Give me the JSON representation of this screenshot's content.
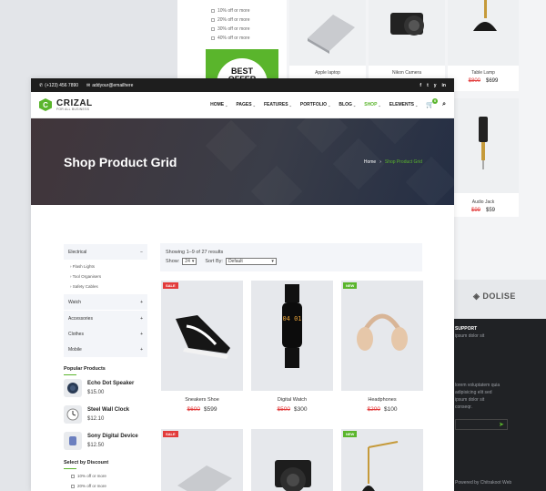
{
  "bg": {
    "discounts": [
      "10% off or more",
      "20% off or more",
      "30% off or more",
      "40% off or more"
    ],
    "offer_text": "BEST OFFER",
    "products": [
      {
        "name": "Apple laptop",
        "old": "",
        "price": ""
      },
      {
        "name": "Nikon Camera",
        "old": "",
        "price": ""
      },
      {
        "name": "Table Lamp",
        "old": "$800",
        "price": "$699"
      },
      {
        "name": "Audio Jack",
        "old": "$99",
        "price": "$59"
      }
    ],
    "footer": {
      "logo": "DOLISE",
      "support_title": "SUPPORT",
      "support_text": "ipsum dolor sit",
      "lines": [
        "lorem voluptatem quia",
        "adipisicing elit sed",
        "ipsum dolor sit",
        "conseqr."
      ],
      "copyright": "Powered by Chitrakoot Web"
    }
  },
  "topbar": {
    "phone": "(+123) 456 7890",
    "email": "addyour@emailhere",
    "social": [
      "f",
      "t",
      "y",
      "in"
    ]
  },
  "brand": {
    "name": "CRIZAL",
    "tagline": "FOR ALL BUSINESS"
  },
  "menu": [
    {
      "label": "HOME",
      "active": false
    },
    {
      "label": "PAGES",
      "active": false
    },
    {
      "label": "FEATURES",
      "active": false
    },
    {
      "label": "PORTFOLIO",
      "active": false
    },
    {
      "label": "BLOG",
      "active": false
    },
    {
      "label": "SHOP",
      "active": true
    },
    {
      "label": "ELEMENTS",
      "active": false
    }
  ],
  "cart_count": "0",
  "banner": {
    "title": "Shop Product Grid",
    "crumb_home": "Home",
    "crumb_current": "Shop Product Grid"
  },
  "sidebar": {
    "categories": [
      {
        "label": "Electrical",
        "sign": "−"
      },
      {
        "label": "Watch",
        "sign": "+"
      },
      {
        "label": "Accessories",
        "sign": "+"
      },
      {
        "label": "Clothes",
        "sign": "+"
      },
      {
        "label": "Mobile",
        "sign": "+"
      }
    ],
    "subcategories": [
      "Flash Lights",
      "Tool Organisers",
      "Safety Cables"
    ],
    "popular_title": "Popular Products",
    "popular": [
      {
        "name": "Echo Dot Speaker",
        "price": "$15.00"
      },
      {
        "name": "Steel Wall Clock",
        "price": "$12.10"
      },
      {
        "name": "Sony Digital Device",
        "price": "$12.50"
      }
    ],
    "discount_title": "Select by Discount",
    "discounts": [
      "10% off or more",
      "20% off or more"
    ]
  },
  "toolbar": {
    "results": "Showing 1–9 of 27 results",
    "show_label": "Show:",
    "show_value": "24",
    "sort_label": "Sort By:",
    "sort_value": "Default"
  },
  "products": [
    {
      "name": "Sneakers Shoe",
      "old": "$600",
      "price": "$599",
      "tag": "SALE"
    },
    {
      "name": "Digital Watch",
      "old": "$500",
      "price": "$300",
      "tag": ""
    },
    {
      "name": "Headphones",
      "old": "$200",
      "price": "$100",
      "tag": "NEW"
    },
    {
      "name": "",
      "old": "",
      "price": "",
      "tag": "SALE"
    },
    {
      "name": "",
      "old": "",
      "price": "",
      "tag": ""
    },
    {
      "name": "",
      "old": "",
      "price": "",
      "tag": "NEW"
    }
  ],
  "watch_display": "04 01",
  "colors": {
    "accent": "#5ab52c",
    "sale": "#e23b3b",
    "dark": "#1e1e1e"
  }
}
